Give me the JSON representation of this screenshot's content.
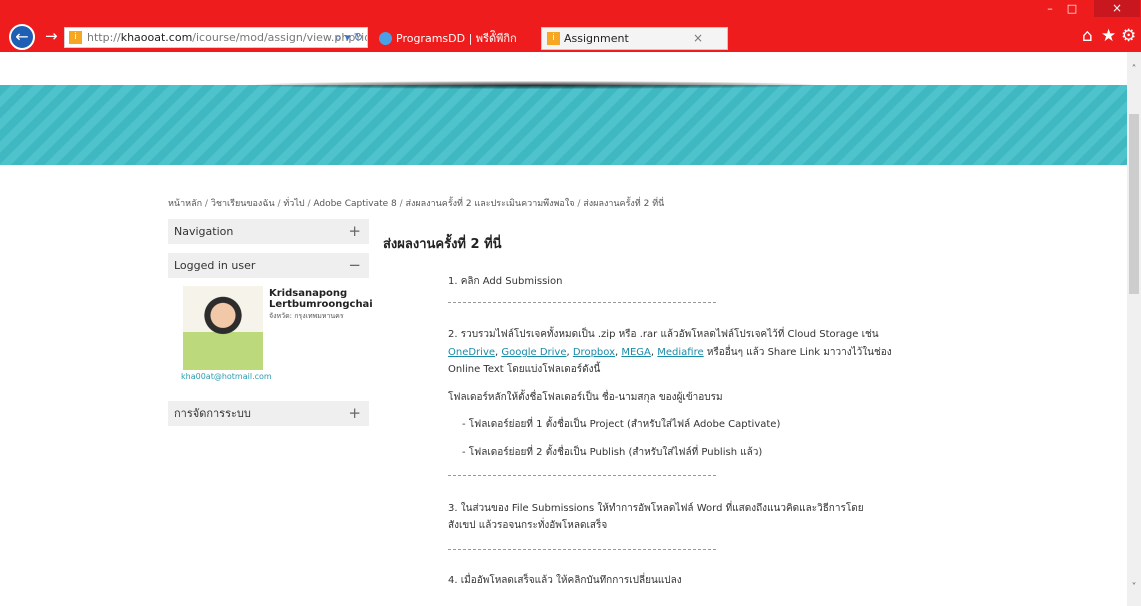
{
  "browser": {
    "address": {
      "scheme": "http://",
      "host": "khaooat.com",
      "path": "/icourse/mod/assign/view.php?id",
      "tools": "⌕ ▾ ↻"
    },
    "tabs": [
      {
        "label": "ProgramsDD | พรีดัิพีกิก"
      },
      {
        "label": "Assignment",
        "close": "×"
      }
    ],
    "window_buttons": {
      "minimize": "–",
      "maximize": "□",
      "close": "×"
    },
    "icons": {
      "back": "back-arrow-icon",
      "forward": "forward-arrow-icon",
      "home": "home-icon",
      "favorites": "star-icon",
      "settings": "gear-icon"
    },
    "glyphs": {
      "back": "←",
      "forward": "→",
      "home": "⌂",
      "star": "★",
      "gear": "⚙",
      "scroll_up": "˄",
      "scroll_down": "˅"
    },
    "accent": "#ee1c1c"
  },
  "breadcrumb": [
    "หน้าหลัก",
    "วิชาเรียนของฉัน",
    "ทั่วไป",
    "Adobe Captivate 8",
    "ส่งผลงานครั้งที่ 2 และประเมินความพึงพอใจ",
    "ส่งผลงานครั้งที่ 2 ที่นี่"
  ],
  "breadcrumb_sep": " / ",
  "sidebar": {
    "navigation": {
      "title": "Navigation",
      "toggle": "+"
    },
    "logged_in": {
      "title": "Logged in user",
      "toggle": "−"
    },
    "user": {
      "first_name": "Kridsanapong",
      "last_name": "Lertbumroongchai",
      "province": "จังหวัด: กรุงเทพมหานคร",
      "email": "kha00at@hotmail.com"
    },
    "admin": {
      "title": "การจัดการระบบ",
      "toggle": "+"
    }
  },
  "main": {
    "title": "ส่งผลงานครั้งที่ 2 ที่นี่",
    "step1": "1. คลิก Add Submission",
    "step2_prefix": "2. รวบรวมไฟล์โปรเจคทั้งหมดเป็น .zip หรือ .rar แล้วอัพโหลดไฟล์โปรเจคไว้ที่ Cloud Storage เช่น",
    "links": [
      "OneDrive",
      "Google Drive",
      "Dropbox",
      "MEGA",
      "Mediafire"
    ],
    "link_sep": ", ",
    "step2_after_links": " หรืออื่นๆ แล้ว Share Link มาวางไว้ในช่อง",
    "step2_tail": "Online Text โดยแบ่งโฟลเดอร์ดังนี้",
    "folder_main": "โฟลเดอร์หลักให้ตั้งชื่อโฟลเดอร์เป็น ชื่อ-นามสกุล ของผู้เข้าอบรม",
    "sub1": "- โฟลเดอร์ย่อยที่ 1 ตั้งชื่อเป็น Project (สำหรับใส่ไฟล์ Adobe Captivate)",
    "sub2": "- โฟลเดอร์ย่อยที่ 2 ตั้งชื่อเป็น Publish (สำหรับใส่ไฟล์ที่ Publish แล้ว)",
    "step3_a": "3. ในส่วนของ File Submissions ให้ทำการอัพโหลดไฟล์ Word ที่แสดงถึงแนวคิดและวิธีการโดย",
    "step3_b": "สังเขป แล้วรอจนกระทั่งอัพโหลดเสร็จ",
    "step4": "4. เมื่ออัพโหลดเสร็จแล้ว ให้คลิกบันทึกการเปลี่ยนแปลง"
  },
  "colors": {
    "banner": "#3fb8c2",
    "link": "#1a8aa8",
    "block_header": "#efefef"
  }
}
